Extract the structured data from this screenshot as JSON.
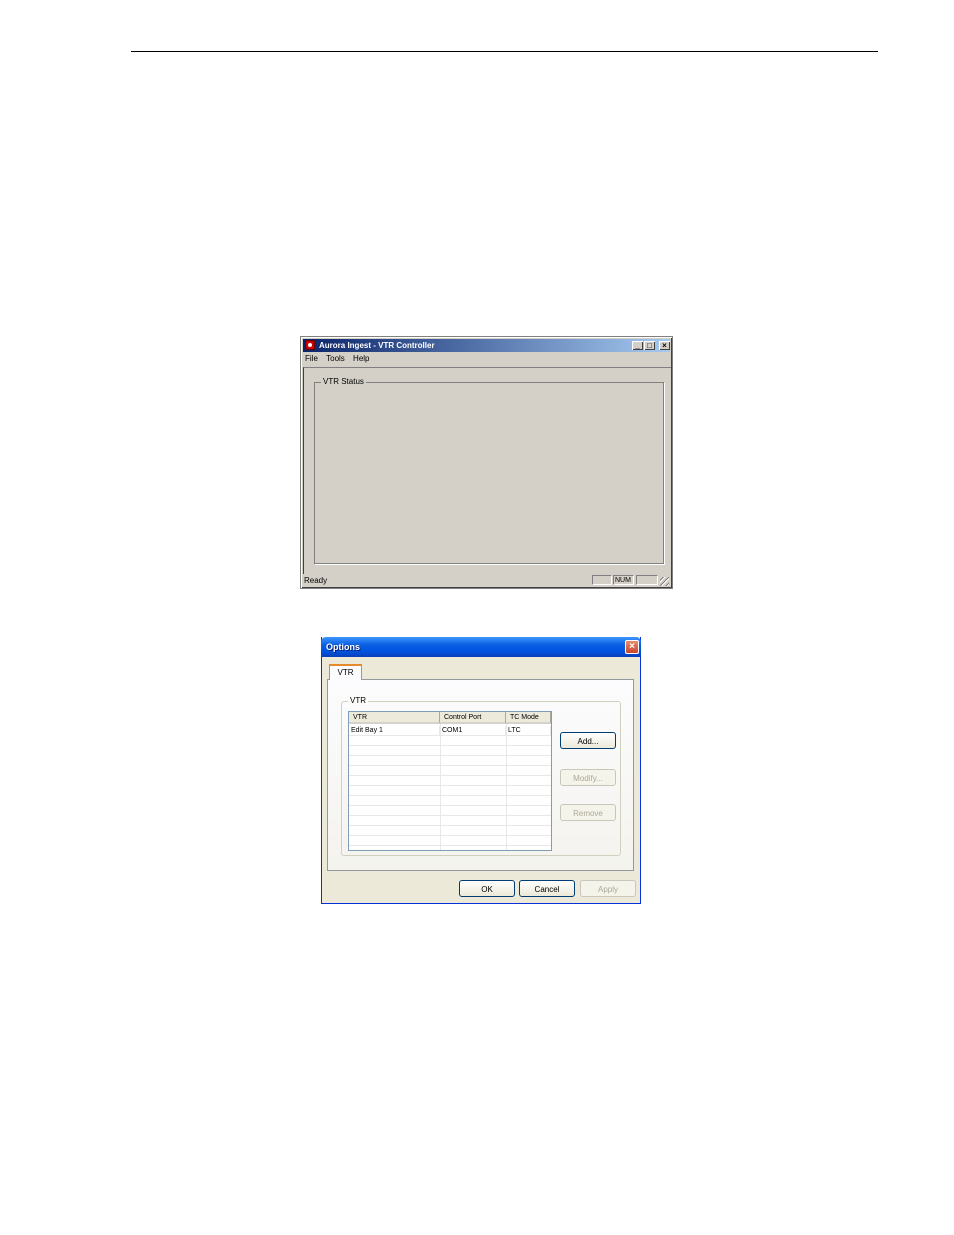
{
  "window1": {
    "title": "Aurora Ingest - VTR Controller",
    "menu": [
      "File",
      "Tools",
      "Help"
    ],
    "group_label": "VTR Status",
    "status_text": "Ready",
    "status_num": "NUM"
  },
  "window2": {
    "title": "Options",
    "tab_label": "VTR",
    "group_label": "VTR",
    "columns": [
      "VTR",
      "Control Port",
      "TC Mode"
    ],
    "rows": [
      [
        "Edit Bay 1",
        "COM1",
        "LTC"
      ]
    ],
    "buttons": {
      "add": "Add...",
      "modify": "Modify...",
      "remove": "Remove",
      "ok": "OK",
      "cancel": "Cancel",
      "apply": "Apply"
    }
  }
}
